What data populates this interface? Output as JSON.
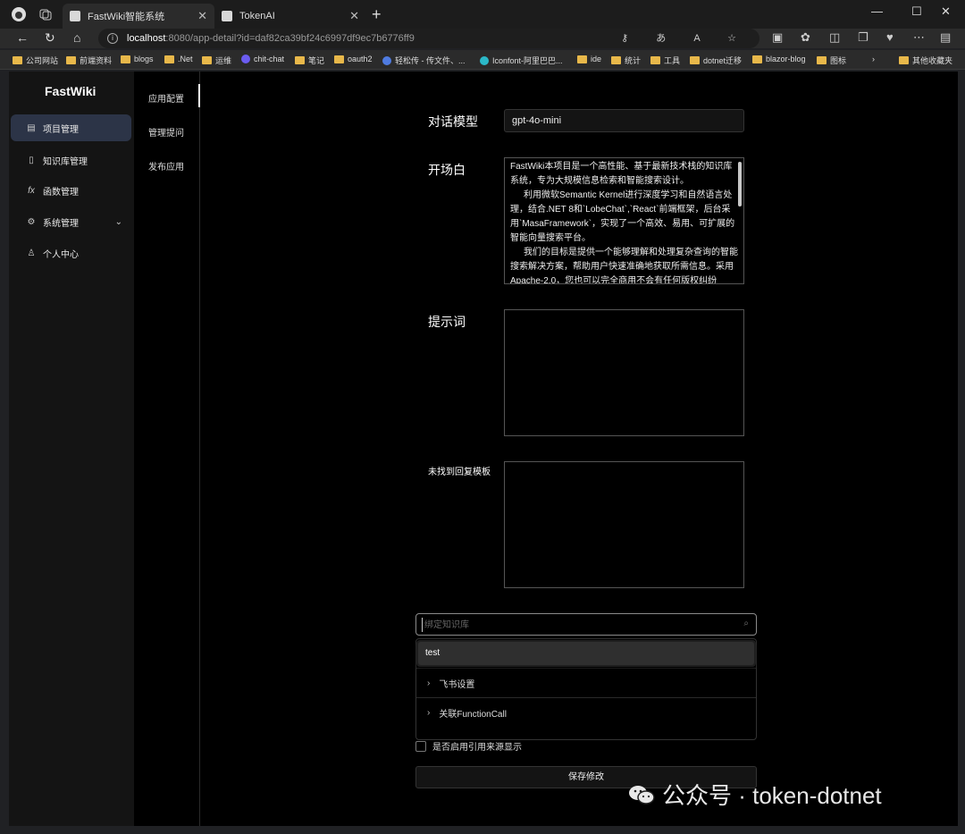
{
  "browser": {
    "tabs": [
      {
        "title": "FastWiki智能系统",
        "active": true
      },
      {
        "title": "TokenAI",
        "active": false
      }
    ],
    "address": {
      "host": "localhost",
      "path": ":8080/app-detail?id=daf82ca39bf24c6997df9ec7b6776ff9"
    },
    "bookmarks": [
      {
        "label": "公司网站",
        "type": "folder"
      },
      {
        "label": "前端资料",
        "type": "folder"
      },
      {
        "label": "blogs",
        "type": "folder"
      },
      {
        "label": ".Net",
        "type": "folder"
      },
      {
        "label": "运维",
        "type": "folder"
      },
      {
        "label": "chit-chat",
        "type": "site"
      },
      {
        "label": "笔记",
        "type": "folder"
      },
      {
        "label": "oauth2",
        "type": "folder"
      },
      {
        "label": "轻松传 - 传文件、...",
        "type": "site"
      },
      {
        "label": "Iconfont-阿里巴巴...",
        "type": "site"
      },
      {
        "label": "ide",
        "type": "folder"
      },
      {
        "label": "统计",
        "type": "folder"
      },
      {
        "label": "工具",
        "type": "folder"
      },
      {
        "label": "dotnet迁移",
        "type": "folder"
      },
      {
        "label": "blazor-blog",
        "type": "folder"
      },
      {
        "label": "图标",
        "type": "folder"
      },
      {
        "label": "其他收藏夹",
        "type": "folder"
      }
    ]
  },
  "app": {
    "logo": "FastWiki",
    "menu": [
      {
        "label": "项目管理",
        "icon": "project-icon",
        "active": true
      },
      {
        "label": "知识库管理",
        "icon": "document-icon",
        "active": false
      },
      {
        "label": "函数管理",
        "icon": "function-icon",
        "active": false
      },
      {
        "label": "系统管理",
        "icon": "gear-icon",
        "active": false,
        "expandable": true
      },
      {
        "label": "个人中心",
        "icon": "user-icon",
        "active": false
      }
    ],
    "submenu": [
      {
        "label": "应用配置",
        "active": true
      },
      {
        "label": "管理提问",
        "active": false
      },
      {
        "label": "发布应用",
        "active": false
      }
    ]
  },
  "form": {
    "model_label": "对话模型",
    "model_value": "gpt-4o-mini",
    "opening_label": "开场白",
    "opening_lines": [
      "FastWiki本项目是一个高性能、基于最新技术栈的知识库系统，专为大规模信息检索和智能搜索设计。",
      "利用微软Semantic Kernel进行深度学习和自然语言处理，结合.NET 8和`LobeChat`,`React`前端框架，后台采用`MasaFramework`，实现了一个高效、易用、可扩展的智能向量搜索平台。",
      "我们的目标是提供一个能够理解和处理复杂查询的智能搜索解决方案，帮助用户快速准确地获取所需信息。采用Apache-2.0，您也可以完全商用不会有任何版权纠纷"
    ],
    "prompt_label": "提示词",
    "prompt_value": "",
    "no_reply_label": "未找到回复模板",
    "no_reply_value": "",
    "kb_search_placeholder": "绑定知识库",
    "kb_dropdown_option": "test",
    "collapse_items": [
      "飞书设置",
      "关联FunctionCall"
    ],
    "show_source_label": "是否启用引用来源显示",
    "save_label": "保存修改"
  },
  "watermark": "公众号 · token-dotnet"
}
